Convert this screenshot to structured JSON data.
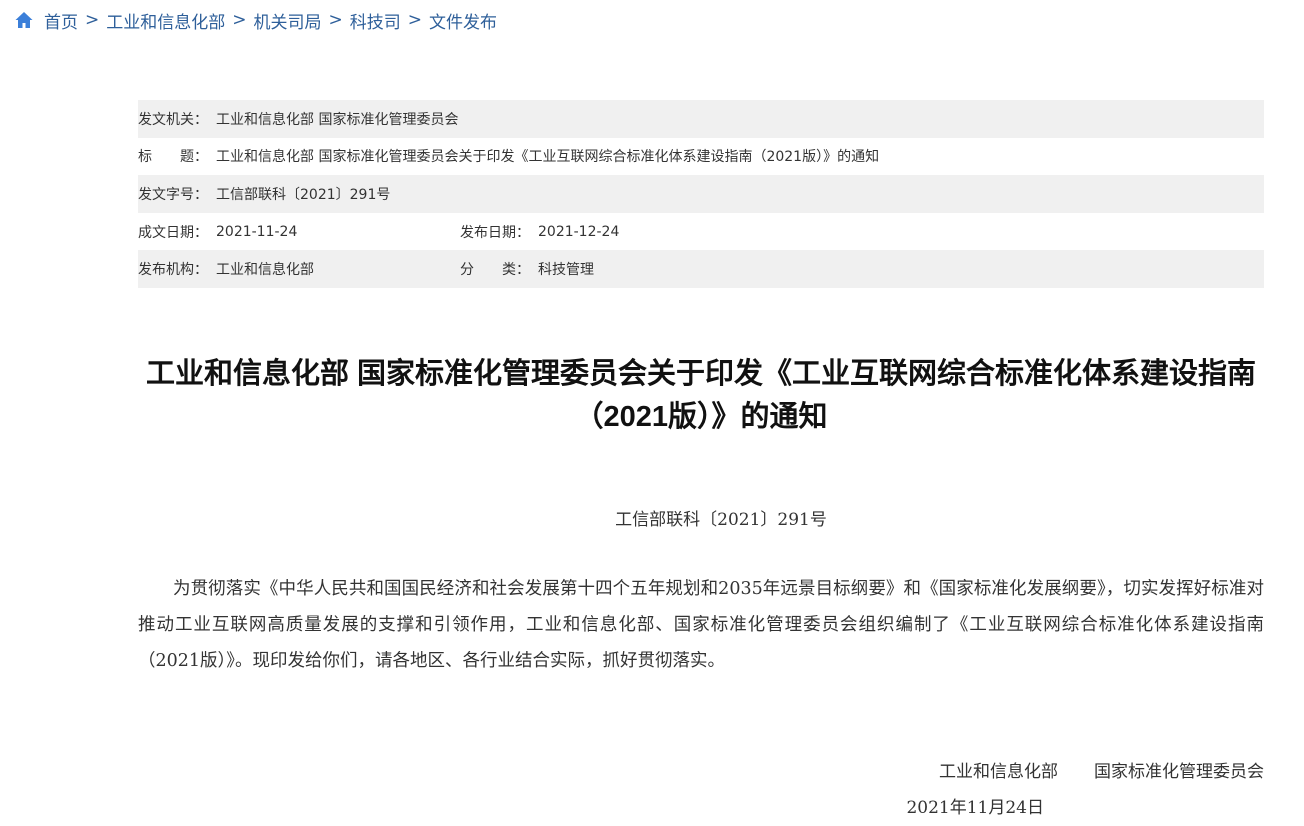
{
  "breadcrumb": {
    "home_icon": "home-icon",
    "items": [
      "首页",
      "工业和信息化部",
      "机关司局",
      "科技司",
      "文件发布"
    ],
    "separator": ">"
  },
  "meta": {
    "issuer_label": "发文机关：",
    "issuer": "工业和信息化部 国家标准化管理委员会",
    "title_label": "标　　题：",
    "title_value": "工业和信息化部 国家标准化管理委员会关于印发《工业互联网综合标准化体系建设指南（2021版）》的通知",
    "docno_label": "发文字号：",
    "docno_value": "工信部联科〔2021〕291号",
    "written_label": "成文日期：",
    "written_value": "2021-11-24",
    "published_label": "发布日期：",
    "published_value": "2021-12-24",
    "org_label": "发布机构：",
    "org_value": "工业和信息化部",
    "category_label": "分　　类：",
    "category_value": "科技管理"
  },
  "article": {
    "title": "工业和信息化部 国家标准化管理委员会关于印发《工业互联网综合标准化体系建设指南（2021版）》的通知",
    "doc_number": "工信部联科〔2021〕291号",
    "paragraph": "为贯彻落实《中华人民共和国国民经济和社会发展第十四个五年规划和2035年远景目标纲要》和《国家标准化发展纲要》，切实发挥好标准对推动工业互联网高质量发展的支撑和引领作用，工业和信息化部、国家标准化管理委员会组织编制了《工业互联网综合标准化体系建设指南（2021版）》。现印发给你们，请各地区、各行业结合实际，抓好贯彻落实。",
    "signer_1": "工业和信息化部",
    "signer_2": "国家标准化管理委员会",
    "date": "2021年11月24日"
  },
  "colors": {
    "link": "#2e5f9a",
    "row_shade": "#f0f0f0",
    "home_icon": "#3b7fd9"
  }
}
